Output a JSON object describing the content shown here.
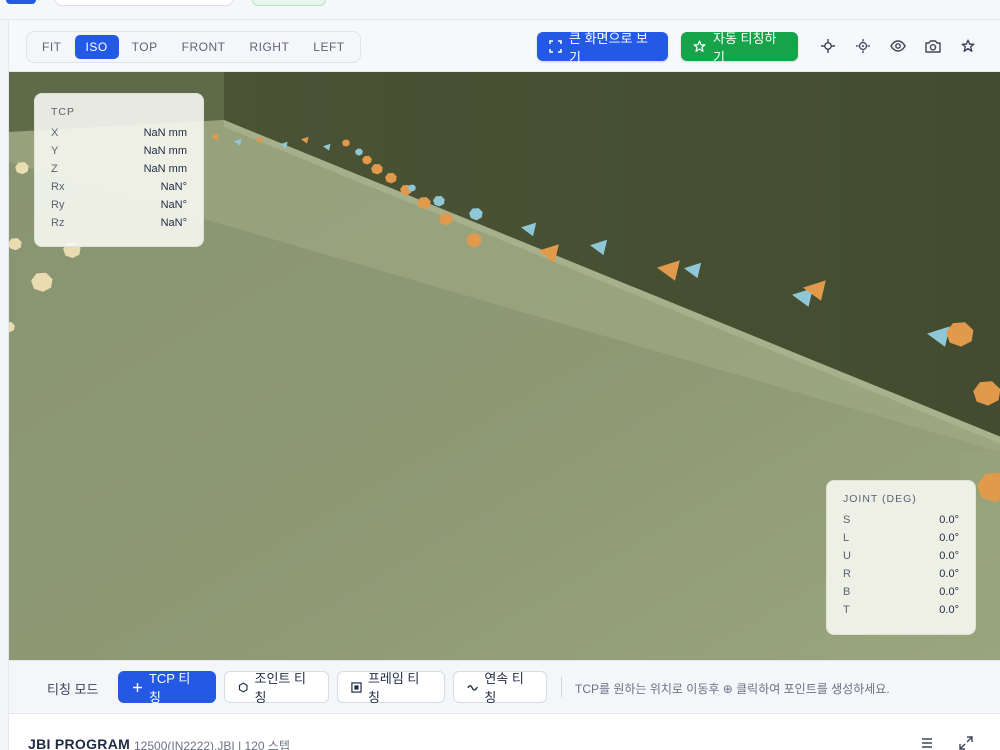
{
  "toolbar": {
    "views": [
      {
        "label": "FIT",
        "active": false
      },
      {
        "label": "ISO",
        "active": true
      },
      {
        "label": "TOP",
        "active": false
      },
      {
        "label": "FRONT",
        "active": false
      },
      {
        "label": "RIGHT",
        "active": false
      },
      {
        "label": "LEFT",
        "active": false
      }
    ],
    "fullscreen_label": "큰 화면으로 보기",
    "auto_teach_label": "자동 티칭하기",
    "icons": [
      "crosshair-icon",
      "target-icon",
      "eye-icon",
      "camera-icon",
      "star-icon"
    ]
  },
  "tcp": {
    "title": "TCP",
    "rows": [
      {
        "key": "X",
        "value": "NaN mm"
      },
      {
        "key": "Y",
        "value": "NaN mm"
      },
      {
        "key": "Z",
        "value": "NaN mm"
      },
      {
        "key": "Rx",
        "value": "NaN°"
      },
      {
        "key": "Ry",
        "value": "NaN°"
      },
      {
        "key": "Rz",
        "value": "NaN°"
      }
    ]
  },
  "joint": {
    "title": "JOINT (DEG)",
    "rows": [
      {
        "key": "S",
        "value": "0.0°"
      },
      {
        "key": "L",
        "value": "0.0°"
      },
      {
        "key": "U",
        "value": "0.0°"
      },
      {
        "key": "R",
        "value": "0.0°"
      },
      {
        "key": "B",
        "value": "0.0°"
      },
      {
        "key": "T",
        "value": "0.0°"
      }
    ]
  },
  "mode": {
    "label": "티칭 모드",
    "buttons": [
      {
        "label": "TCP 티칭",
        "icon": "plus-icon",
        "primary": true
      },
      {
        "label": "조인트 티칭",
        "icon": "hexagon-icon",
        "primary": false
      },
      {
        "label": "프레임 티칭",
        "icon": "frame-icon",
        "primary": false
      },
      {
        "label": "연속 티칭",
        "icon": "wave-icon",
        "primary": false
      }
    ],
    "hint": "TCP를 원하는 위치로 이동후 ⊕ 클릭하여 포인트를 생성하세요."
  },
  "program": {
    "title": "JBI PROGRAM",
    "meta": "12500(IN2222).JBI | 120 스텝"
  },
  "colors": {
    "primary": "#2459e6",
    "success": "#16a34a",
    "point_orange": "#e19a4c",
    "point_blue": "#8fc7d6",
    "point_cream": "#e8dcb0"
  }
}
